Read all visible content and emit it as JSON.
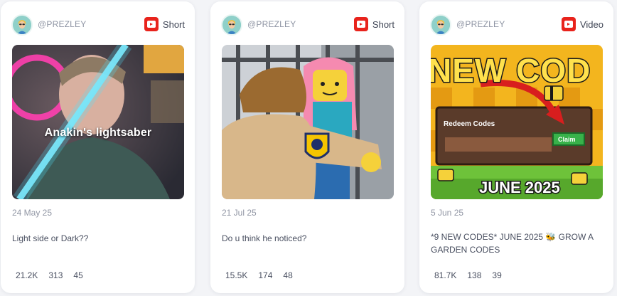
{
  "cards": [
    {
      "handle": "@PREZLEY",
      "type": "Short",
      "overlay": "Anakin's lightsaber",
      "date": "24 May 25",
      "title": "Light side or Dark??",
      "stats": [
        "21.2K",
        "313",
        "45"
      ]
    },
    {
      "handle": "@PREZLEY",
      "type": "Short",
      "date": "21 Jul 25",
      "title": "Do u think he noticed?",
      "stats": [
        "15.5K",
        "174",
        "48"
      ]
    },
    {
      "handle": "@PREZLEY",
      "type": "Video",
      "thumb_text": {
        "headline": "NEW COD",
        "redeem": "Redeem Codes",
        "claim": "Claim",
        "month": "JUNE 2025"
      },
      "date": "5 Jun 25",
      "title": "*9 NEW CODES* JUNE 2025 🐝 GROW A GARDEN CODES",
      "stats": [
        "81.7K",
        "138",
        "39"
      ]
    }
  ],
  "icons": {
    "platform": "youtube-icon"
  },
  "colors": {
    "youtube_red": "#e8231c",
    "card_bg": "#ffffff",
    "page_bg": "#f3f4f7"
  }
}
